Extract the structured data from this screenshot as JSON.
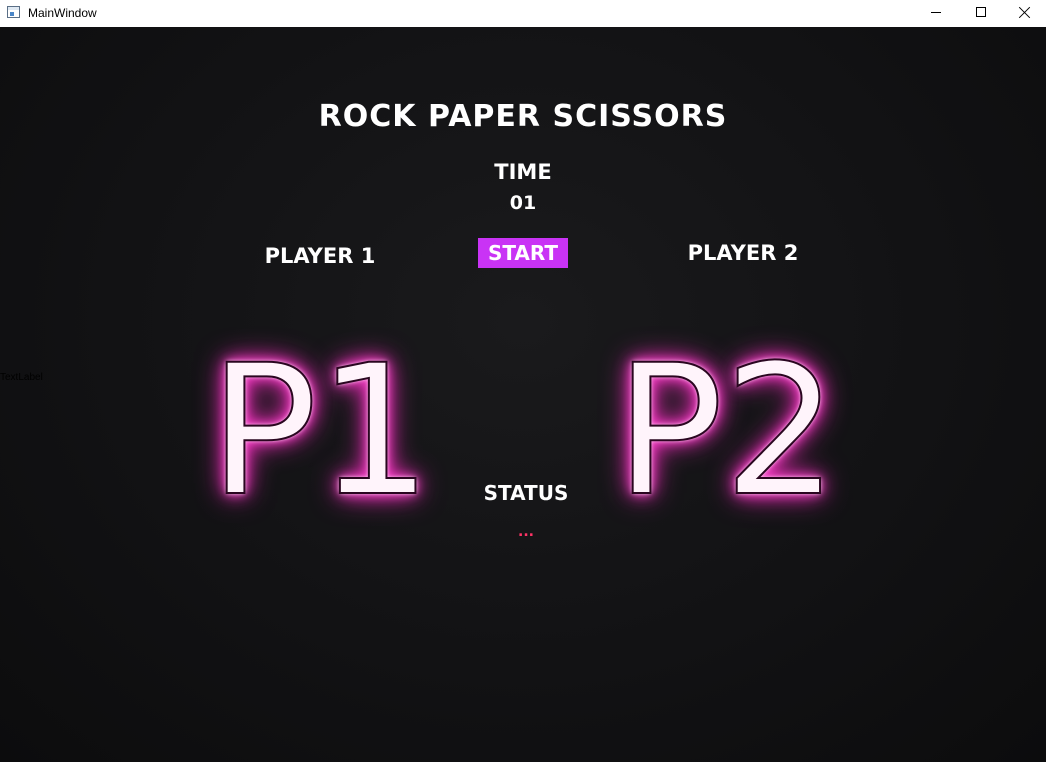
{
  "window": {
    "title": "MainWindow",
    "icon": "app-window-icon",
    "controls": {
      "minimize_icon": "minimize-icon",
      "maximize_icon": "maximize-icon",
      "close_icon": "close-icon"
    }
  },
  "game": {
    "title": "ROCK PAPER SCISSORS",
    "time_label": "TIME",
    "time_value": "01",
    "start_label": "START",
    "player1_label": "PLAYER 1",
    "player2_label": "PLAYER 2",
    "placeholder_label": "TextLabel",
    "player1_display": "P1",
    "player2_display": "P2",
    "status_label": "STATUS",
    "status_value": "..."
  },
  "colors": {
    "background": "#121214",
    "start_button": "#c933f5",
    "neon_glow": "#ff2fc6",
    "status_value": "#ff3366",
    "text": "#ffffff"
  }
}
